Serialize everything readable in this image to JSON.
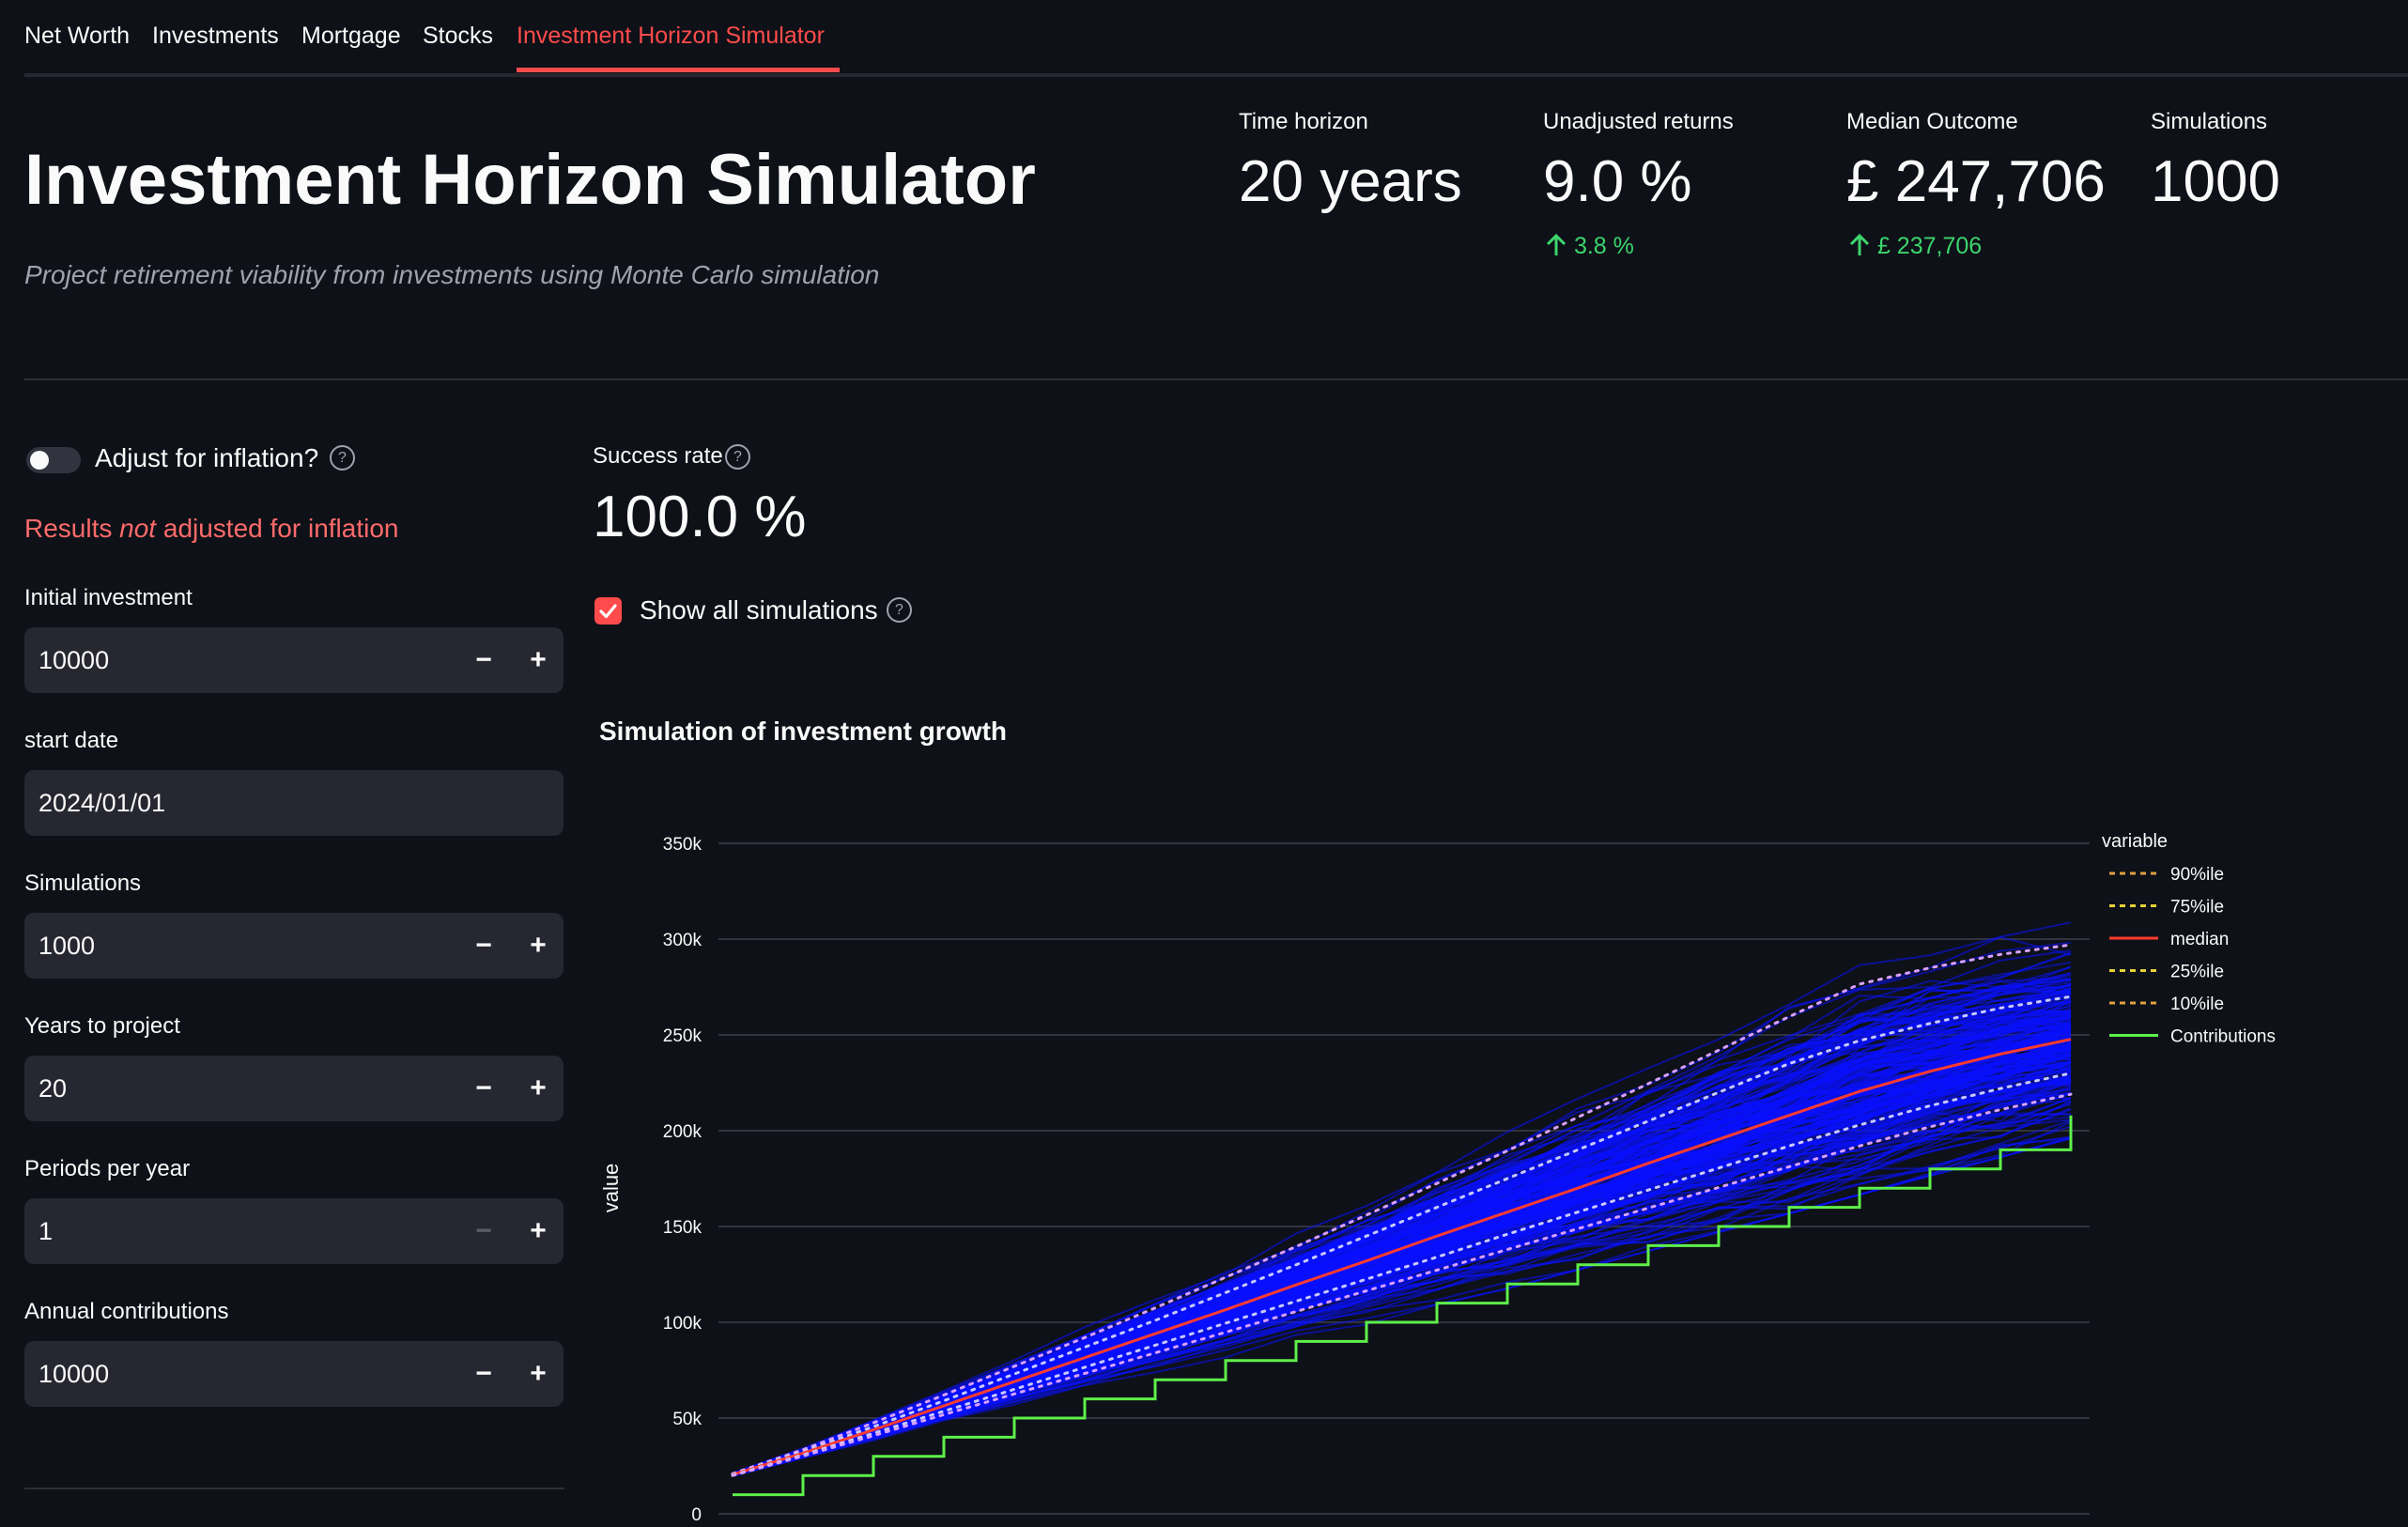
{
  "tabs": [
    {
      "label": "Net Worth"
    },
    {
      "label": "Investments"
    },
    {
      "label": "Mortgage"
    },
    {
      "label": "Stocks"
    },
    {
      "label": "Investment Horizon Simulator",
      "active": true
    }
  ],
  "header": {
    "title": "Investment Horizon Simulator",
    "subtitle": "Project retirement viability from investments using Monte Carlo simulation"
  },
  "metrics": [
    {
      "label": "Time horizon",
      "value": "20 years",
      "delta": ""
    },
    {
      "label": "Unadjusted returns",
      "value": "9.0 %",
      "delta": "3.8 %"
    },
    {
      "label": "Median Outcome",
      "value": "£ 247,706",
      "delta": "£ 237,706"
    },
    {
      "label": "Simulations",
      "value": "1000",
      "delta": ""
    }
  ],
  "sidebar": {
    "inflation_toggle": {
      "label": "Adjust for inflation?",
      "on": false
    },
    "warning": {
      "pre": "Results ",
      "emph": "not",
      "post": " adjusted for inflation"
    },
    "fields": [
      {
        "label": "Initial investment",
        "value": "10000",
        "stepper": true
      },
      {
        "label": "start date",
        "value": "2024/01/01",
        "stepper": false
      },
      {
        "label": "Simulations",
        "value": "1000",
        "stepper": true
      },
      {
        "label": "Years to project",
        "value": "20",
        "stepper": true
      },
      {
        "label": "Periods per year",
        "value": "1",
        "stepper": true
      },
      {
        "label": "Annual contributions",
        "value": "10000",
        "stepper": true
      }
    ],
    "stepper_minus": "−",
    "stepper_plus": "+"
  },
  "success": {
    "label": "Success rate",
    "value": "100.0 %"
  },
  "show_all": {
    "label": "Show all simulations",
    "checked": true
  },
  "colors": {
    "accent": "#ff4b4b",
    "delta_positive": "#3dd56d",
    "simulations": "#0a10ff",
    "median": "#ff3b30",
    "pct_outer": "#e0a040",
    "pct_inner": "#e6d23a",
    "contributions": "#5ef04a"
  },
  "icons": {
    "help": "question-circle-icon",
    "check": "check-icon",
    "arrow_up": "arrow-up-icon"
  },
  "chart_data": {
    "type": "line",
    "title": "Simulation of investment growth",
    "xlabel": "",
    "ylabel": "value",
    "ylim": [
      0,
      350000
    ],
    "yticks": [
      0,
      50000,
      100000,
      150000,
      200000,
      250000,
      300000,
      350000
    ],
    "ytick_labels": [
      "0",
      "50k",
      "100k",
      "150k",
      "200k",
      "250k",
      "300k",
      "350k"
    ],
    "x": [
      0,
      1,
      2,
      3,
      4,
      5,
      6,
      7,
      8,
      9,
      10,
      11,
      12,
      13,
      14,
      15,
      16,
      17,
      18,
      19
    ],
    "grid": true,
    "legend_title": "variable",
    "legend_position": "right",
    "series": [
      {
        "name": "90%ile",
        "style": "dotted",
        "values": [
          21000,
          33500,
          47500,
          62000,
          77000,
          92000,
          107500,
          123500,
          139500,
          156000,
          172500,
          189500,
          207000,
          224500,
          242000,
          259500,
          276500,
          285000,
          292000,
          297000
        ]
      },
      {
        "name": "75%ile",
        "style": "dotted",
        "values": [
          20800,
          32500,
          45500,
          59000,
          73000,
          87000,
          101000,
          115500,
          130000,
          145000,
          160000,
          175000,
          190000,
          205000,
          220000,
          235000,
          247000,
          256000,
          264000,
          270000
        ]
      },
      {
        "name": "median",
        "style": "solid",
        "values": [
          20500,
          31700,
          43800,
          56400,
          69000,
          81500,
          94000,
          106500,
          119500,
          132000,
          145000,
          157500,
          170000,
          183000,
          195500,
          208000,
          220500,
          231000,
          240000,
          247706
        ]
      },
      {
        "name": "25%ile",
        "style": "dotted",
        "values": [
          20200,
          30800,
          42000,
          53600,
          65000,
          76500,
          88000,
          99500,
          111000,
          122500,
          134000,
          146000,
          157500,
          169000,
          180500,
          192000,
          203000,
          213000,
          222000,
          230000
        ]
      },
      {
        "name": "10%ile",
        "style": "dotted",
        "values": [
          20000,
          30200,
          40800,
          51800,
          62600,
          73300,
          84000,
          94800,
          105600,
          116400,
          127200,
          138000,
          148800,
          159600,
          170400,
          181200,
          192000,
          202000,
          211000,
          219000
        ]
      },
      {
        "name": "Contributions",
        "style": "step",
        "values": [
          10000,
          20000,
          30000,
          40000,
          50000,
          60000,
          70000,
          80000,
          90000,
          100000,
          110000,
          120000,
          130000,
          140000,
          150000,
          160000,
          170000,
          180000,
          190000,
          200000
        ]
      }
    ]
  }
}
